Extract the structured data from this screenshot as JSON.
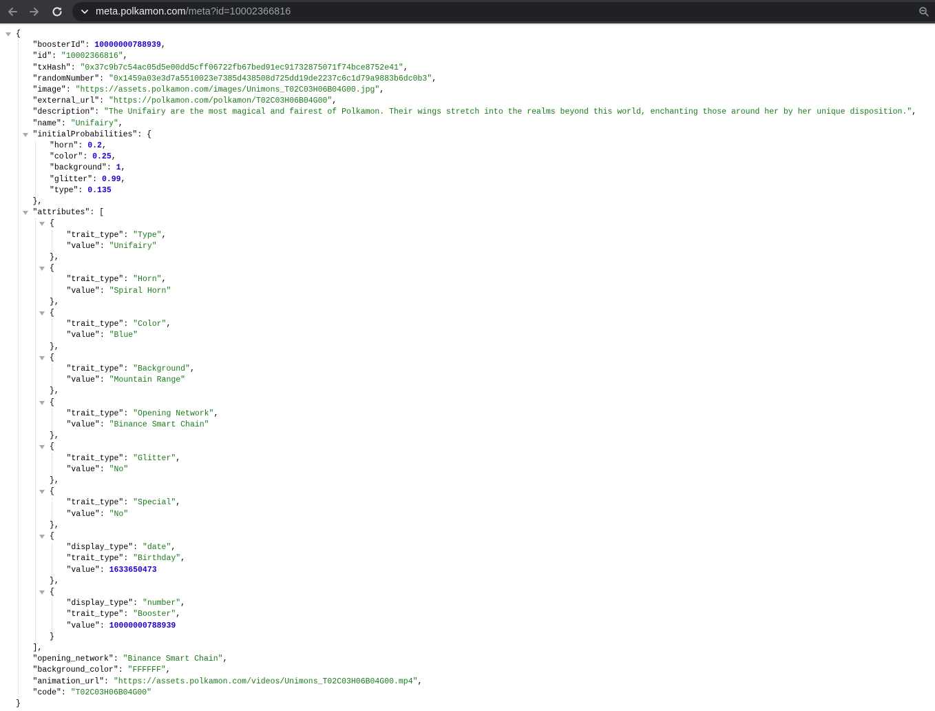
{
  "browser": {
    "url_host": "meta.polkamon.com",
    "url_path": "/meta?id=10002366816"
  },
  "json": {
    "boosterId": 10000000788939,
    "id": "10002366816",
    "txHash": "0x37c9b7c54ac05d5e00dd5cff06722fb67bed91ec91732875071f74bce8752e41",
    "randomNumber": "0x1459a03e3d7a5510023e7385d438508d725dd19de2237c6c1d79a9883b6dc0b3",
    "image": "https://assets.polkamon.com/images/Unimons_T02C03H06B04G00.jpg",
    "external_url": "https://polkamon.com/polkamon/T02C03H06B04G00",
    "description": "The Unifairy are the most magical and fairest of Polkamon. Their wings stretch into the realms beyond this world, enchanting those around her by her unique disposition.",
    "name": "Unifairy",
    "initialProbabilities": {
      "horn": 0.2,
      "color": 0.25,
      "background": 1,
      "glitter": 0.99,
      "type": 0.135
    },
    "attributes": [
      {
        "trait_type": "Type",
        "value": "Unifairy"
      },
      {
        "trait_type": "Horn",
        "value": "Spiral Horn"
      },
      {
        "trait_type": "Color",
        "value": "Blue"
      },
      {
        "trait_type": "Background",
        "value": "Mountain Range"
      },
      {
        "trait_type": "Opening Network",
        "value": "Binance Smart Chain"
      },
      {
        "trait_type": "Glitter",
        "value": "No"
      },
      {
        "trait_type": "Special",
        "value": "No"
      },
      {
        "display_type": "date",
        "trait_type": "Birthday",
        "value": 1633650473
      },
      {
        "display_type": "number",
        "trait_type": "Booster",
        "value": 10000000788939
      }
    ],
    "opening_network": "Binance Smart Chain",
    "background_color": "FFFFFF",
    "animation_url": "https://assets.polkamon.com/videos/Unimons_T02C03H06B04G00.mp4",
    "code": "T02C03H06B04G00"
  }
}
